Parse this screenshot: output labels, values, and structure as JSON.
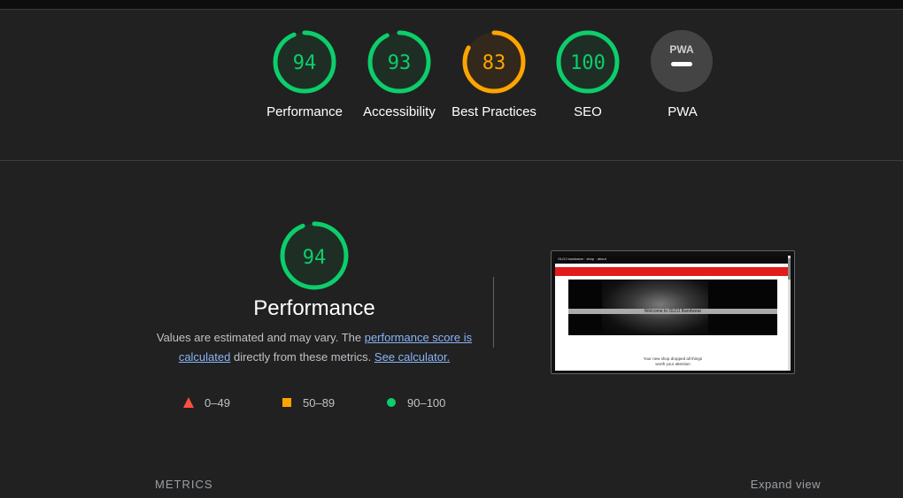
{
  "colors": {
    "pass": "#0cce6b",
    "average": "#ffa400",
    "fail": "#ff4e42",
    "link": "#8ab4f8"
  },
  "gauges": [
    {
      "label": "Performance",
      "score": "94",
      "value": 94,
      "rating": "pass"
    },
    {
      "label": "Accessibility",
      "score": "93",
      "value": 93,
      "rating": "pass"
    },
    {
      "label": "Best Practices",
      "score": "83",
      "value": 83,
      "rating": "average"
    },
    {
      "label": "SEO",
      "score": "100",
      "value": 100,
      "rating": "pass"
    },
    {
      "label": "PWA",
      "badge": "PWA",
      "rating": "na"
    }
  ],
  "performance": {
    "score": "94",
    "value": 94,
    "title": "Performance",
    "desc_part1": "Values are estimated and may vary. The ",
    "link_score": "performance score is calculated",
    "desc_part2": " directly from these metrics. ",
    "link_calculator": "See calculator."
  },
  "legend": [
    {
      "icon": "triangle-icon",
      "range": "0–49"
    },
    {
      "icon": "square-icon",
      "range": "50–89"
    },
    {
      "icon": "circle-icon",
      "range": "90–100"
    }
  ],
  "screenshot": {
    "nav_text": "OLDJ bandwear · shop · about",
    "heading": "Welcome to OLDJ Bandwear",
    "body_line1": "Your new shop dropped all things",
    "body_line2": "worth your attention"
  },
  "metrics_label": "METRICS",
  "expand_label": "Expand view"
}
